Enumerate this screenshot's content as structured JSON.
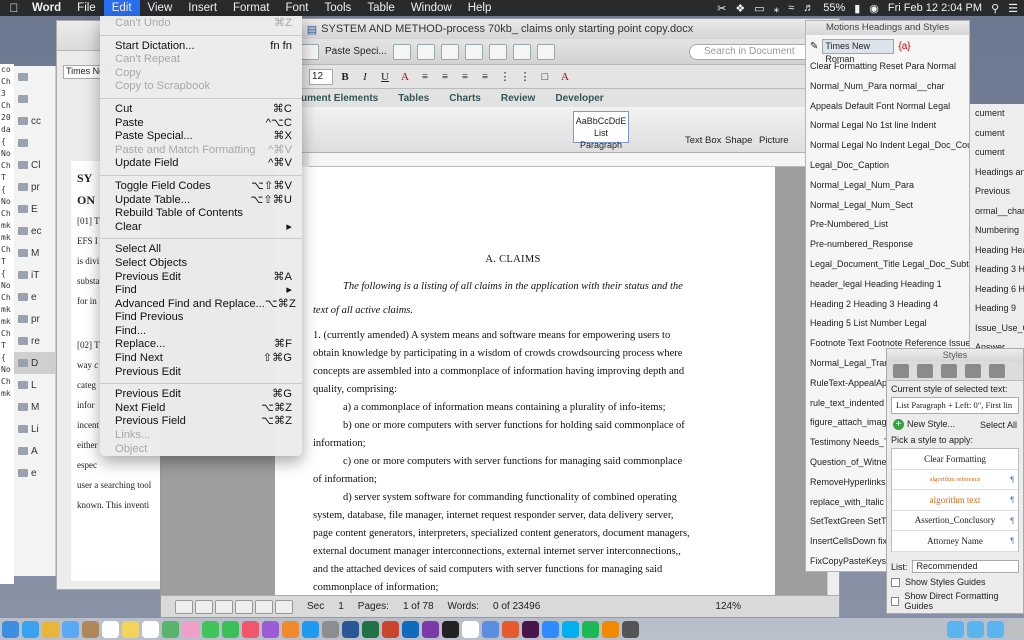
{
  "menubar": {
    "app": "Word",
    "menus": [
      "File",
      "Edit",
      "View",
      "Insert",
      "Format",
      "Font",
      "Tools",
      "Table",
      "Window",
      "Help"
    ],
    "battery": "55%",
    "clock": "Fri Feb 12  2:04 PM"
  },
  "edit_menu": {
    "items": [
      {
        "label": "Can't Undo",
        "shortcut": "⌘Z",
        "enabled": false
      },
      {
        "sep": true
      },
      {
        "label": "Start Dictation...",
        "shortcut": "fn fn",
        "enabled": true
      },
      {
        "label": "Can't Repeat",
        "shortcut": "",
        "enabled": false
      },
      {
        "label": "Copy",
        "shortcut": "",
        "enabled": false
      },
      {
        "label": "Copy to Scrapbook",
        "shortcut": "",
        "enabled": false
      },
      {
        "sep": true
      },
      {
        "label": "Cut",
        "shortcut": "⌘C",
        "enabled": true
      },
      {
        "label": "Paste",
        "shortcut": "^⌥C",
        "enabled": true
      },
      {
        "label": "Paste Special...",
        "shortcut": "⌘X",
        "enabled": true
      },
      {
        "label": "Paste and Match Formatting",
        "shortcut": "^⌘V",
        "enabled": false
      },
      {
        "label": "Update Field",
        "shortcut": "^⌘V",
        "enabled": true
      },
      {
        "sep": true
      },
      {
        "label": "Toggle Field Codes",
        "shortcut": "⌥⇧⌘V",
        "enabled": true
      },
      {
        "label": "Update Table...",
        "shortcut": "⌥⇧⌘U",
        "enabled": true
      },
      {
        "label": "Rebuild Table of Contents",
        "shortcut": "",
        "enabled": true
      },
      {
        "label": "Clear",
        "shortcut": "▸",
        "enabled": true
      },
      {
        "sep": true
      },
      {
        "label": "Select All",
        "shortcut": "",
        "enabled": true
      },
      {
        "label": "Select Objects",
        "shortcut": "",
        "enabled": true
      },
      {
        "label": "Previous Edit",
        "shortcut": "⌘A",
        "enabled": true
      },
      {
        "label": "Find",
        "shortcut": "▸",
        "enabled": true
      },
      {
        "label": "Advanced Find and Replace...",
        "shortcut": "⌥⌘Z",
        "enabled": true
      },
      {
        "label": "Find Previous",
        "shortcut": "",
        "enabled": true
      },
      {
        "label": "Find...",
        "shortcut": "",
        "enabled": true
      },
      {
        "label": "Replace...",
        "shortcut": "⌘F",
        "enabled": true
      },
      {
        "label": "Find Next",
        "shortcut": "⇧⌘G",
        "enabled": true
      },
      {
        "label": "Previous Edit",
        "shortcut": "",
        "enabled": true
      },
      {
        "sep": true
      },
      {
        "label": "Previous Edit",
        "shortcut": "⌘G",
        "enabled": true
      },
      {
        "label": "Next Field",
        "shortcut": "⌥⌘Z",
        "enabled": true
      },
      {
        "label": "Previous Field",
        "shortcut": "⌥⌘Z",
        "enabled": true
      },
      {
        "label": "Links...",
        "shortcut": "",
        "enabled": false
      },
      {
        "label": "Object",
        "shortcut": "",
        "enabled": false
      }
    ]
  },
  "main_window": {
    "title": "SYSTEM AND METHOD-process 70kb_ claims only starting point copy.docx",
    "search_placeholder": "Search in Document",
    "paste_special": "Paste Speci...",
    "font_size": "12",
    "ribbon_tabs": [
      "ument Elements",
      "Tables",
      "Charts",
      "Review",
      "Developer"
    ],
    "style_preview": "AaBbCcDdE",
    "style_name": "List Paragraph",
    "ribbon_labels": [
      "Text Box",
      "Shape",
      "Picture"
    ],
    "document": {
      "heading": "A.      CLAIMS",
      "intro": "The following is a listing of all claims in the application with their status and the text of all active claims.",
      "claim1": "1. (currently amended) A system means and software means for empowering users to obtain knowledge by participating in a wisdom of crowds crowdsourcing process where concepts are assembled into a commonplace of information having improving depth and quality, comprising:",
      "a": "a) a commonplace of information means containing a plurality of info-items;",
      "b": "b) one or more computers with server functions for holding said commonplace of information;",
      "c": "c) one or more computers with server functions for managing said commonplace of information;",
      "d": "d) server system software for commanding functionality of combined operating system, database, file manager, internet request responder server, data delivery server, page content generators, interpreters, specialized content generators, document managers, external document manager interconnections, external internet server interconnections,, and the attached devices of said computers with server functions for managing said commonplace of information;"
    },
    "status": {
      "sec": "Sec",
      "sec_num": "1",
      "pages_label": "Pages:",
      "pages": "1 of 78",
      "words_label": "Words:",
      "words": "0 of 23496",
      "zoom": "124%"
    }
  },
  "doc2": {
    "title_font": "Times New",
    "lines": [
      "SY",
      "ON",
      "[01]   T",
      "EFS I",
      "is divi",
      "substa",
      "for in",
      "[02]   T",
      "way c",
      "categ",
      "infor",
      "incent",
      "either",
      "espec",
      "user a searching tool",
      "known. This inventi"
    ]
  },
  "left_strip": [
    "",
    "",
    "cc",
    "",
    "Cl",
    "pr",
    "E",
    "ec",
    "M",
    "iT",
    "e",
    "pr",
    "re",
    "D",
    "L",
    "M",
    "Li",
    "A",
    "e"
  ],
  "motions": {
    "title": "Motions Headings and Styles",
    "font": "Times New Roman",
    "rows": [
      "Clear Formatting   Reset Para   Normal",
      "Normal_Num_Para   normal__char",
      "Appeals Default Font   Normal Legal",
      "Normal Legal No 1st line Indent",
      "Normal Legal No Indent   Legal_Doc_Court",
      "Legal_Doc_Caption",
      "Normal_Legal_Num_Para",
      "Normal_Legal_Num_Sect",
      "Pre-Numbered_List",
      "Pre-numbered_Response",
      "Legal_Document_Title   Legal_Doc_Subtitle",
      "header_legal   Heading   Heading 1",
      "Heading 2   Heading 3   Heading 4",
      "Heading 5   List Number Legal",
      "Footnote Text   Footnote Reference   Issue",
      "Normal_Legal_Transcript_Indent",
      "RuleText-AppealAppe",
      "rule_text_indented",
      "figure_attach_image",
      "Testimony   Needs_T",
      "Question_of_Witness",
      "RemoveHyperlinksIn",
      "replace_with_Italic   Se",
      "SetTextGreen   SetTe",
      "InsertCellsDown   fix",
      "FixCopyPasteKeys"
    ]
  },
  "right_bg": [
    "cument",
    "cument",
    "cument",
    "Headings and S",
    "Previous",
    "ormal__char",
    "Numbering",
    "Heading   Hea",
    "Heading 3   H",
    "Heading 6   H",
    "Heading 9",
    "Issue_Use_Case",
    "Answer"
  ],
  "styles_palette": {
    "title": "Styles",
    "current_label": "Current style of selected text:",
    "current": "List Paragraph + Left:  0\", First lin",
    "new_style": "New Style...",
    "select_all": "Select All",
    "pick_label": "Pick a style to apply:",
    "styles": [
      "Clear Formatting",
      "algorithm reference",
      "algorithm text",
      "Assertion_Conclusory",
      "Attorney Name"
    ],
    "list_label": "List:",
    "list_value": "Recommended",
    "show_guides": "Show Styles Guides",
    "show_direct": "Show Direct Formatting Guides"
  },
  "colors": {
    "menu_highlight": "#2a6ff0",
    "style_orange": "#d2691e"
  }
}
